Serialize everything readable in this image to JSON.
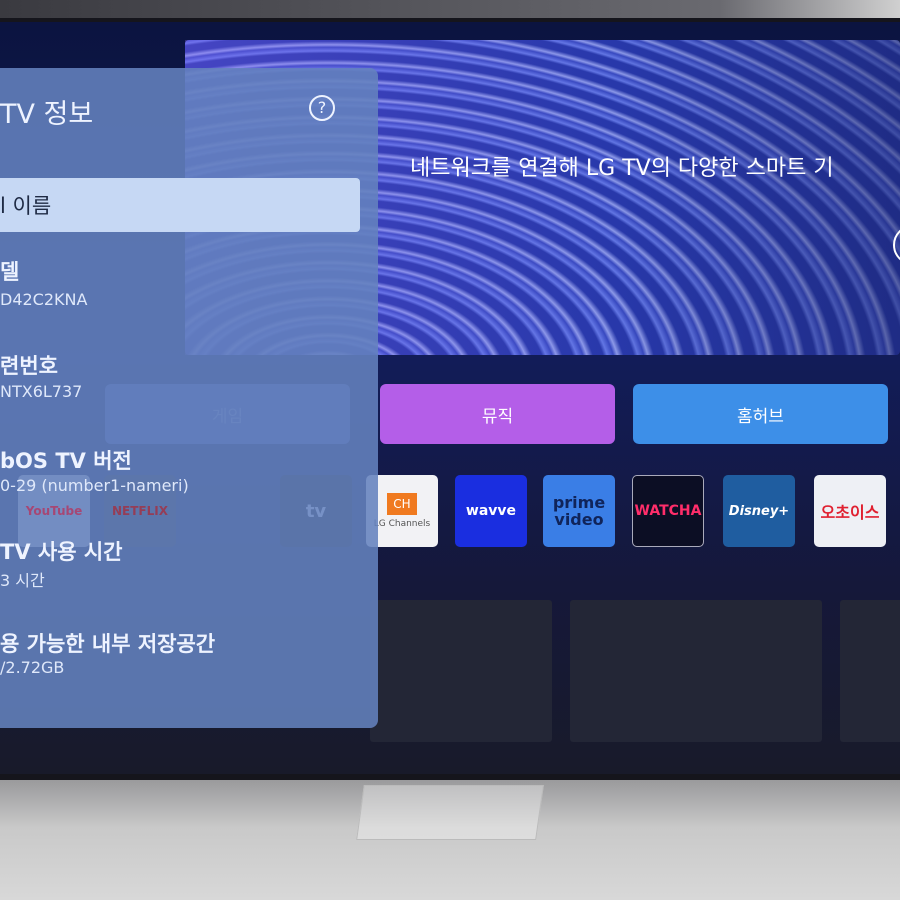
{
  "hero": {
    "text": "네트워크를 연결해 LG TV의 다양한 스마트 기"
  },
  "categories": [
    {
      "label": "게임",
      "color": "#5a6fb0"
    },
    {
      "label": "뮤직",
      "color": "#b45ee8"
    },
    {
      "label": "홈허브",
      "color": "#3d8fe8"
    }
  ],
  "apps": [
    {
      "name": "YouTube",
      "label": "YouTube"
    },
    {
      "name": "Netflix",
      "label": "NETFLIX"
    },
    {
      "name": "Apple TV",
      "label": "tv"
    },
    {
      "name": "LG Channels",
      "label": "LG Channels",
      "badge": "CH"
    },
    {
      "name": "wavve",
      "label": "wavve",
      "color": "#1a2ee0"
    },
    {
      "name": "prime video",
      "label": "prime video",
      "color": "#3a7ee6"
    },
    {
      "name": "WATCHA",
      "label": "WATCHA",
      "color": "#0c0e24"
    },
    {
      "name": "Disney+",
      "label": "Disney+",
      "color": "#1f5da0"
    },
    {
      "name": "오초이스",
      "label": "오초이스",
      "color": "#eef0f5"
    }
  ],
  "panel": {
    "title": "TV 정보",
    "help_icon": "question-circle-icon",
    "selected": "l 이름",
    "items": [
      {
        "label": "델",
        "value": "D42C2KNA"
      },
      {
        "label": "련번호",
        "value": "NTX6L737"
      },
      {
        "label": "bOS TV 버전",
        "value": "0-29 (number1-nameri)"
      },
      {
        "label": "TV 사용 시간",
        "value": "3 시간"
      },
      {
        "label": "용 가능한 내부 저장공간",
        "value": "/2.72GB"
      }
    ]
  }
}
